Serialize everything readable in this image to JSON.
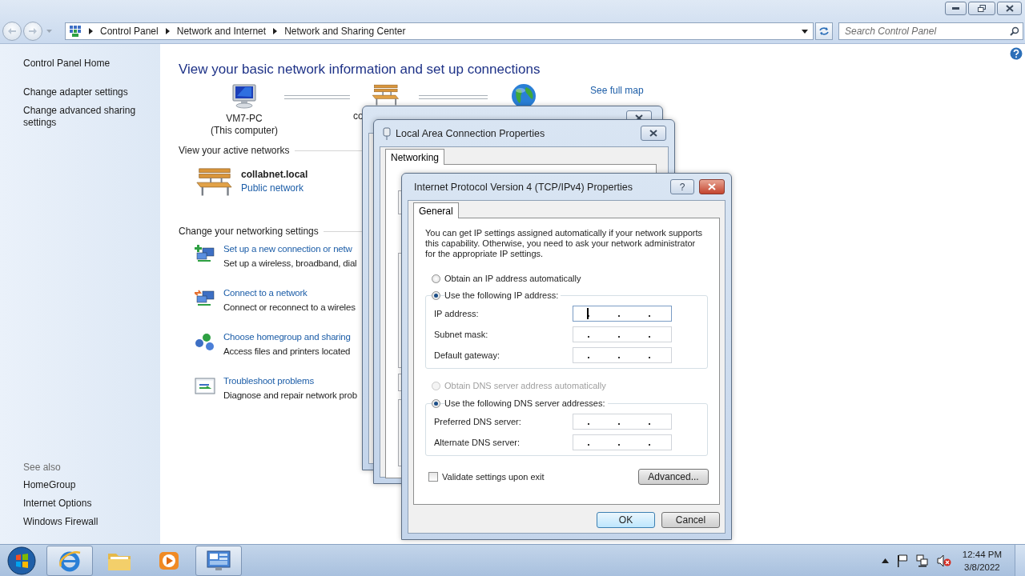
{
  "address_bar": {
    "breadcrumbs": [
      "Control Panel",
      "Network and Internet",
      "Network and Sharing Center"
    ]
  },
  "search": {
    "placeholder": "Search Control Panel"
  },
  "sidebar": {
    "links": [
      "Control Panel Home",
      "Change adapter settings",
      "Change advanced sharing settings"
    ],
    "see_also": {
      "heading": "See also",
      "links": [
        "HomeGroup",
        "Internet Options",
        "Windows Firewall"
      ]
    }
  },
  "main": {
    "heading": "View your basic network information and set up connections",
    "map": {
      "nodes": [
        {
          "kind": "computer",
          "name": "VM7-PC",
          "caption": "(This computer)"
        },
        {
          "kind": "network",
          "name": "co"
        },
        {
          "kind": "internet"
        }
      ],
      "link": "See full map"
    },
    "active_networks": {
      "heading": "View your active networks",
      "networks": [
        {
          "name": "collabnet.local",
          "type": "Public network"
        }
      ]
    },
    "settings": {
      "heading": "Change your networking settings",
      "tasks": [
        {
          "kind": "new_connection",
          "title": "Set up a new connection or netw",
          "description": "Set up a wireless, broadband, dial"
        },
        {
          "kind": "connect",
          "title": "Connect to a network",
          "description": "Connect or reconnect to a wireles"
        },
        {
          "kind": "homegroup",
          "title": "Choose homegroup and sharing",
          "description": "Access files and printers located"
        },
        {
          "kind": "troubleshoot",
          "title": "Troubleshoot problems",
          "description": "Diagnose and repair network prob"
        }
      ]
    }
  },
  "dialogs": {
    "properties": {
      "title": "Local Area Connection Properties",
      "tabs": [
        {
          "label": "Networking",
          "selected": true
        }
      ]
    },
    "ipv4": {
      "title": "Internet Protocol Version 4 (TCP/IPv4) Properties",
      "help": "?",
      "tabs": [
        {
          "label": "General",
          "selected": true
        }
      ],
      "intro": "You can get IP settings assigned automatically if your network supports this capability. Otherwise, you need to ask your network administrator for the appropriate IP settings.",
      "ip_modes": [
        {
          "label": "Obtain an IP address automatically",
          "selected": false,
          "disabled": false
        },
        {
          "label": "Use the following IP address:",
          "selected": true,
          "disabled": false
        }
      ],
      "ip_fields": [
        {
          "label": "IP address:",
          "focused": true
        },
        {
          "label": "Subnet mask:",
          "focused": false
        },
        {
          "label": "Default gateway:",
          "focused": false
        }
      ],
      "dns_modes": [
        {
          "label": "Obtain DNS server address automatically",
          "selected": false,
          "disabled": true
        },
        {
          "label": "Use the following DNS server addresses:",
          "selected": true,
          "disabled": false
        }
      ],
      "dns_fields": [
        {
          "label": "Preferred DNS server:",
          "focused": false
        },
        {
          "label": "Alternate DNS server:",
          "focused": false
        }
      ],
      "validate": {
        "label": "Validate settings upon exit",
        "checked": false
      },
      "advanced": "Advanced...",
      "buttons": [
        {
          "label": "OK",
          "default": true
        },
        {
          "label": "Cancel",
          "default": false
        }
      ]
    }
  },
  "taskbar": {
    "apps": [
      {
        "kind": "browser",
        "running": true
      },
      {
        "kind": "folder",
        "running": false
      },
      {
        "kind": "media",
        "running": false
      },
      {
        "kind": "control_panel",
        "running": true
      }
    ],
    "clock": {
      "time": "12:44 PM",
      "date": "3/8/2022"
    }
  }
}
